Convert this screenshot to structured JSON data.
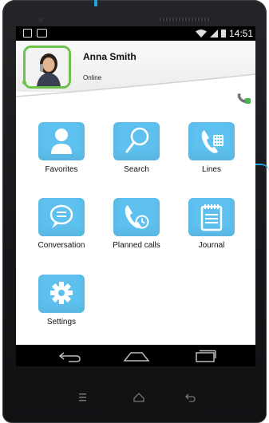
{
  "status_bar": {
    "time": "14:51"
  },
  "profile": {
    "name": "Anna Smith",
    "status": "Online"
  },
  "menu": [
    {
      "label": "Favorites",
      "icon": "person-icon"
    },
    {
      "label": "Search",
      "icon": "magnifier-icon"
    },
    {
      "label": "Lines",
      "icon": "phone-keypad-icon"
    },
    {
      "label": "Conversation",
      "icon": "chat-bubble-icon"
    },
    {
      "label": "Planned calls",
      "icon": "phone-clock-icon"
    },
    {
      "label": "Journal",
      "icon": "notepad-icon"
    },
    {
      "label": "Settings",
      "icon": "gear-icon"
    }
  ],
  "colors": {
    "accent": "#5ec0ee",
    "presence": "#6cc24a",
    "background": "#ffffff"
  }
}
